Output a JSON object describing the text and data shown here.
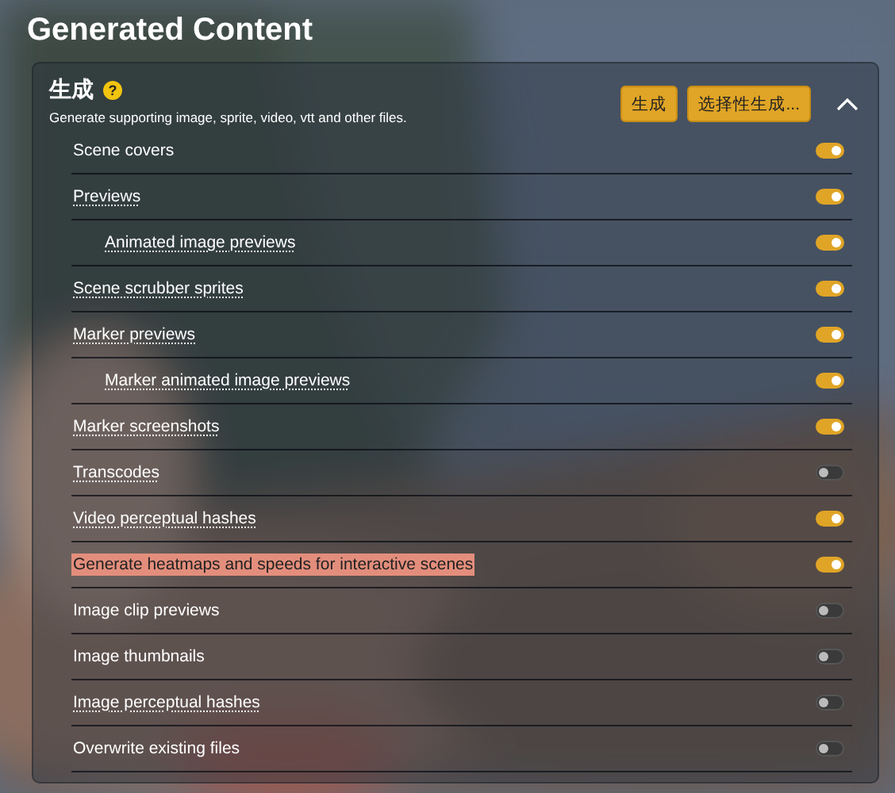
{
  "page_title": "Generated Content",
  "section": {
    "title": "生成",
    "help_icon": "?",
    "description": "Generate supporting image, sprite, video, vtt and other files.",
    "buttons": [
      "生成",
      "选择性生成..."
    ],
    "expanded": true
  },
  "settings": [
    {
      "label": "Scene covers",
      "hint": false,
      "highlighted": false,
      "on": true
    },
    {
      "label": "Previews",
      "hint": true,
      "highlighted": false,
      "on": true,
      "children": [
        {
          "label": "Animated image previews",
          "hint": true,
          "highlighted": false,
          "on": true
        }
      ]
    },
    {
      "label": "Scene scrubber sprites",
      "hint": true,
      "highlighted": false,
      "on": true
    },
    {
      "label": "Marker previews",
      "hint": true,
      "highlighted": false,
      "on": true,
      "children": [
        {
          "label": "Marker animated image previews",
          "hint": true,
          "highlighted": false,
          "on": true
        }
      ]
    },
    {
      "label": "Marker screenshots",
      "hint": true,
      "highlighted": false,
      "on": true
    },
    {
      "label": "Transcodes",
      "hint": true,
      "highlighted": false,
      "on": false
    },
    {
      "label": "Video perceptual hashes",
      "hint": true,
      "highlighted": false,
      "on": true
    },
    {
      "label": "Generate heatmaps and speeds for interactive scenes",
      "hint": false,
      "highlighted": true,
      "on": true
    },
    {
      "label": "Image clip previews",
      "hint": false,
      "highlighted": false,
      "on": false
    },
    {
      "label": "Image thumbnails",
      "hint": false,
      "highlighted": false,
      "on": false
    },
    {
      "label": "Image perceptual hashes",
      "hint": true,
      "highlighted": false,
      "on": false
    },
    {
      "label": "Overwrite existing files",
      "hint": false,
      "highlighted": false,
      "on": false
    }
  ]
}
